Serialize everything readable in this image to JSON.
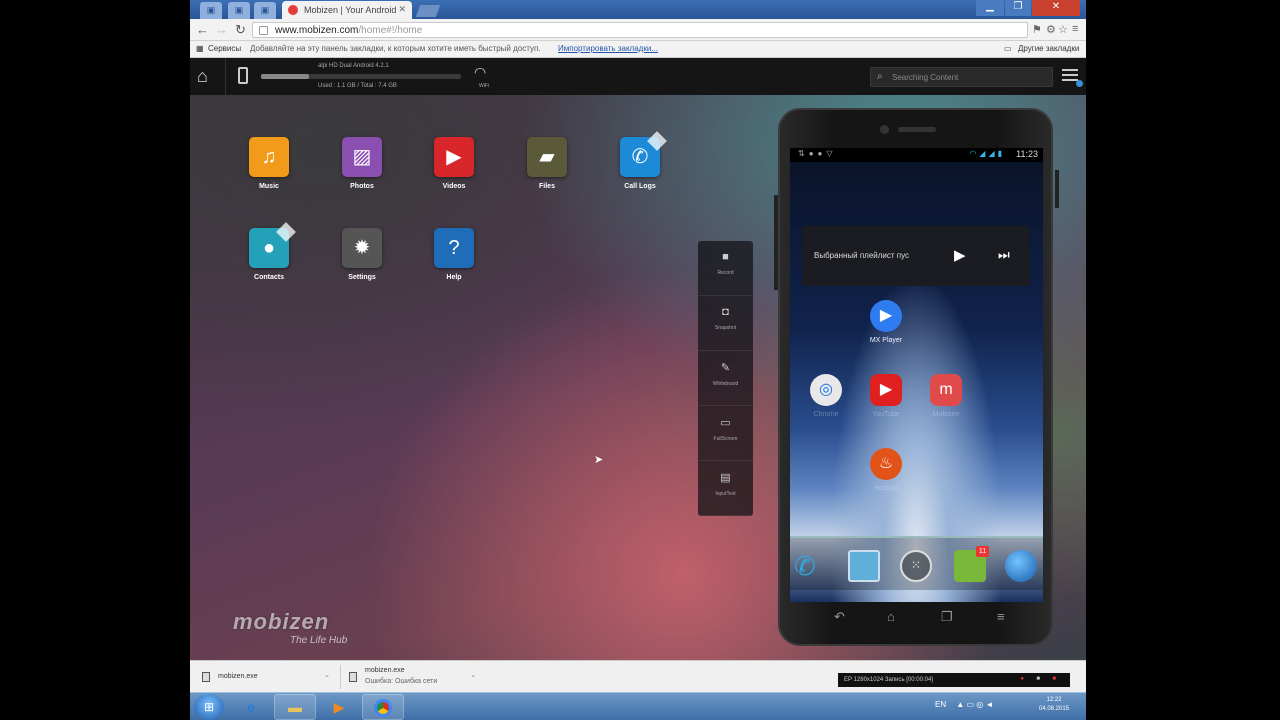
{
  "browser": {
    "tab_title": "Mobizen | Your Android",
    "url_host": "www.mobizen.com",
    "url_path": "/home#!/home",
    "bookmark_services": "Сервисы",
    "bookmark_hint": "Добавляйте на эту панель закладки, к которым хотите иметь быстрый доступ.",
    "bookmark_import": "Импортировать закладки...",
    "bookmark_other": "Другие закладки"
  },
  "header": {
    "device_name": "alpi HD Dual Android 4.2.1",
    "storage_info": "Used : 1.1 GB / Total : 7.4 GB",
    "wifi_label": "WiFi",
    "search_placeholder": "Searching Content",
    "storage_fraction": 0.24
  },
  "apps": [
    {
      "label": "Music",
      "color": "#f29a1a",
      "icon": "music-note-icon"
    },
    {
      "label": "Photos",
      "color": "#8a4fb0",
      "icon": "photo-icon"
    },
    {
      "label": "Videos",
      "color": "#d8262a",
      "icon": "play-icon"
    },
    {
      "label": "Files",
      "color": "#5a5a3a",
      "icon": "folder-icon"
    },
    {
      "label": "Call Logs",
      "color": "#1d8ad8",
      "icon": "phone-icon"
    },
    {
      "label": "Contacts",
      "color": "#24a0b8",
      "icon": "person-icon"
    },
    {
      "label": "Settings",
      "color": "#555555",
      "icon": "gear-icon"
    },
    {
      "label": "Help",
      "color": "#1f6db8",
      "icon": "question-icon"
    }
  ],
  "tools": [
    {
      "label": "Record",
      "icon": "video-camera-icon"
    },
    {
      "label": "Snapshot",
      "icon": "camera-icon"
    },
    {
      "label": "Whiteboard",
      "icon": "pen-icon"
    },
    {
      "label": "FullScreen",
      "icon": "monitor-icon"
    },
    {
      "label": "InputText",
      "icon": "keyboard-icon"
    }
  ],
  "phone": {
    "time": "11:23",
    "widget_text": "Выбранный плейлист пус",
    "apps": [
      {
        "label": "MX Player",
        "color": "#2f7cf0"
      },
      {
        "label": "Chrome",
        "color": "#e8e8e8"
      },
      {
        "label": "YouTube",
        "color": "#e02020"
      },
      {
        "label": "Mobizen",
        "color": "#e04a4a"
      },
      {
        "label": "Hotspot",
        "color": "#e2531a"
      }
    ],
    "dock_badge": "11"
  },
  "brand": {
    "logo": "mobizen",
    "tagline": "The Life Hub"
  },
  "downloads": [
    {
      "name": "mobizen.exe",
      "status": ""
    },
    {
      "name": "mobizen.exe",
      "status": "Ошибка: Ошибка сети"
    }
  ],
  "recorder": {
    "text": "EP  1280x1024  Запись [00:00:04]"
  },
  "taskbar": {
    "lang": "EN",
    "time": "12:22",
    "date": "04.08.2015"
  }
}
